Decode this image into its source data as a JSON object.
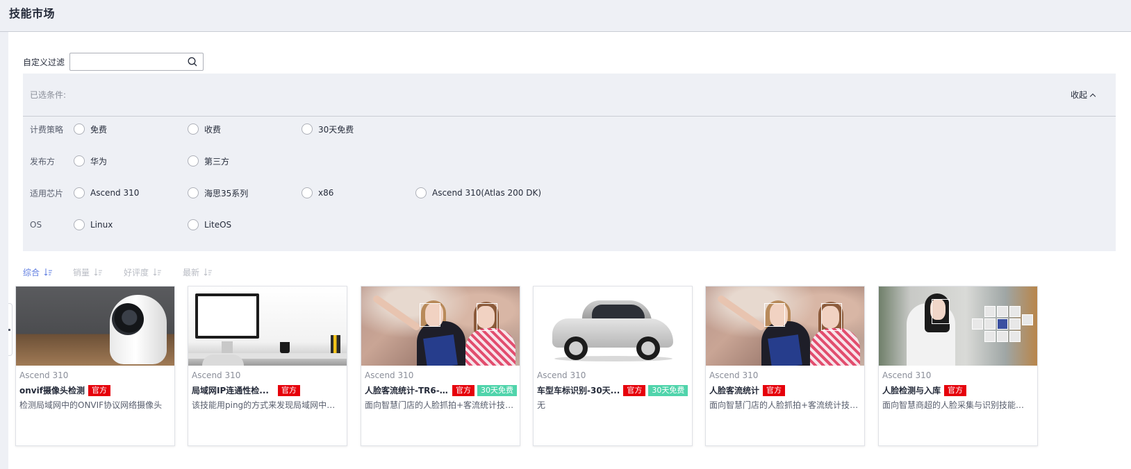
{
  "header": {
    "title": "技能市场"
  },
  "filter": {
    "label": "自定义过滤",
    "search_value": "",
    "search_placeholder": ""
  },
  "conditions": {
    "selected_label": "已选条件:",
    "collapse_label": "收起",
    "groups": [
      {
        "label": "计费策略",
        "options": [
          "免费",
          "收费",
          "30天免费"
        ]
      },
      {
        "label": "发布方",
        "options": [
          "华为",
          "第三方"
        ]
      },
      {
        "label": "适用芯片",
        "options": [
          "Ascend 310",
          "海思35系列",
          "x86",
          "Ascend 310(Atlas 200 DK)"
        ]
      },
      {
        "label": "OS",
        "options": [
          "Linux",
          "LiteOS"
        ]
      }
    ]
  },
  "sort": {
    "items": [
      "综合",
      "销量",
      "好评度",
      "最新"
    ],
    "active": "综合"
  },
  "colors": {
    "accent": "#5e7ce0",
    "official_tag": "#e6000b",
    "free_tag": "#50d4ab"
  },
  "cards": [
    {
      "chip": "Ascend 310",
      "title": "onvif摄像头检测",
      "tags": [
        "官方"
      ],
      "desc": "检测局域网中的ONVIF协议网络摄像头",
      "image": "camera"
    },
    {
      "chip": "Ascend 310",
      "title": "局域网IP连通性检...",
      "tags": [
        "官方"
      ],
      "desc": "该技能用ping的方式来发现局域网中的其...",
      "image": "monitor"
    },
    {
      "chip": "Ascend 310",
      "title": "人脸客流统计-TR6-...",
      "tags": [
        "官方",
        "30天免费"
      ],
      "desc": "面向智慧门店的人脸抓拍+客流统计技能...",
      "image": "people"
    },
    {
      "chip": "Ascend 310",
      "title": "车型车标识别-30天...",
      "tags": [
        "官方",
        "30天免费"
      ],
      "desc": "无",
      "image": "car"
    },
    {
      "chip": "Ascend 310",
      "title": "人脸客流统计",
      "tags": [
        "官方"
      ],
      "desc": "面向智慧门店的人脸抓拍+客流统计技能...",
      "image": "people"
    },
    {
      "chip": "Ascend 310",
      "title": "人脸检测与入库",
      "tags": [
        "官方"
      ],
      "desc": "面向智慧商超的人脸采集与识别技能。本...",
      "image": "face"
    }
  ]
}
